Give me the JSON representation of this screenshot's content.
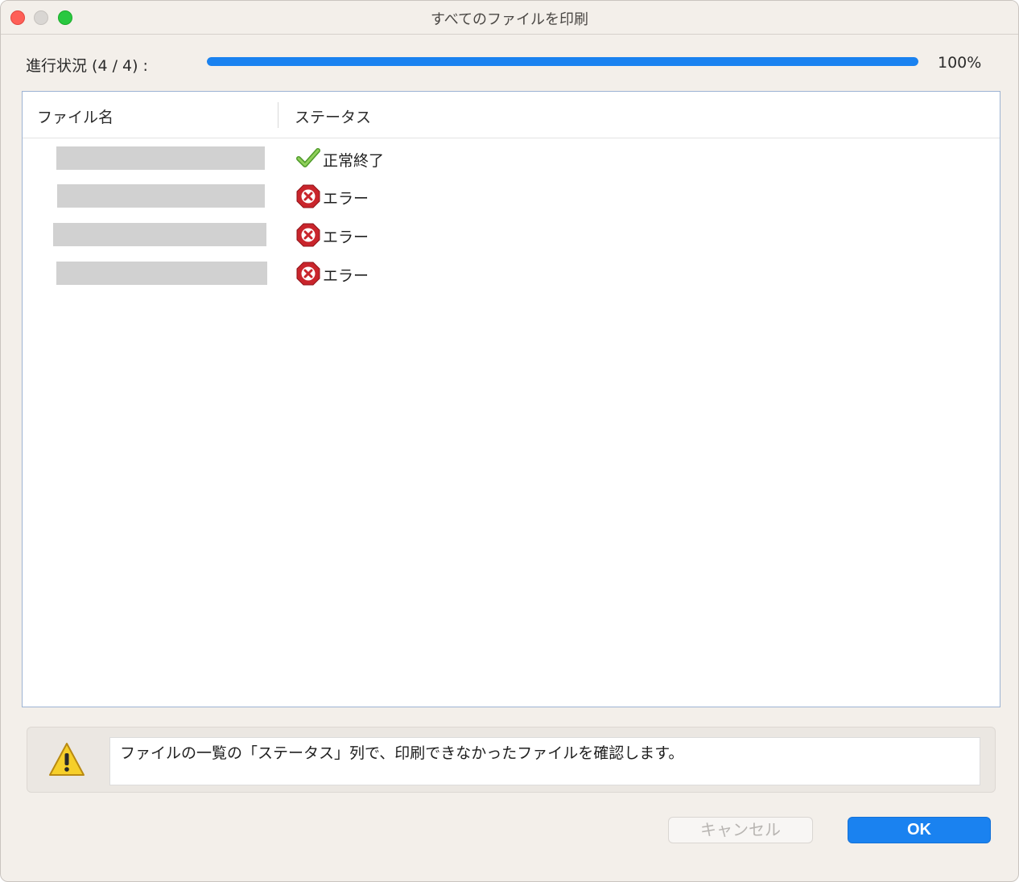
{
  "window": {
    "title": "すべてのファイルを印刷"
  },
  "progress": {
    "label": "進行状況 (4 / 4) :",
    "percent_text": "100%",
    "fraction": 1.0,
    "color": "#1a82f0"
  },
  "table": {
    "columns": [
      "ファイル名",
      "ステータス"
    ],
    "rows": [
      {
        "filename_redacted": true,
        "status": "正常終了",
        "icon": "check-icon"
      },
      {
        "filename_redacted": true,
        "status": "エラー",
        "icon": "error-icon"
      },
      {
        "filename_redacted": true,
        "status": "エラー",
        "icon": "error-icon"
      },
      {
        "filename_redacted": true,
        "status": "エラー",
        "icon": "error-icon"
      }
    ]
  },
  "message": {
    "icon": "warning-icon",
    "text": "ファイルの一覧の「ステータス」列で、印刷できなかったファイルを確認します。"
  },
  "buttons": {
    "cancel_label": "キャンセル",
    "ok_label": "OK"
  }
}
